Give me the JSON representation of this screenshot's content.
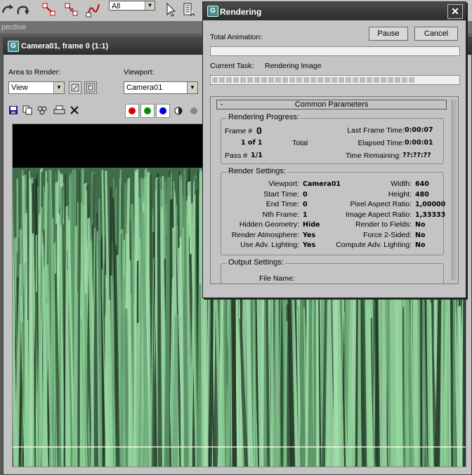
{
  "toolbar": {
    "filter_value": "All",
    "filter_arrow": "▼",
    "icons": [
      "undo-icon",
      "select-link-icon",
      "unlink-icon",
      "bind-space-warp-icon",
      "select-object-icon",
      "select-by-name-icon"
    ]
  },
  "viewport_label": "pective",
  "frame_window": {
    "title": "Camera01, frame 0 (1:1)",
    "app_icon": "G",
    "area_label": "Area to Render:",
    "area_value": "View",
    "viewport_label": "Viewport:",
    "viewport_value": "Camera01",
    "colors": {
      "red": "#e00000",
      "green": "#009000",
      "blue": "#0000d0"
    }
  },
  "rendering_dialog": {
    "title": "Rendering",
    "app_icon": "G",
    "close_glyph": "✕",
    "total_animation_label": "Total Animation:",
    "pause_label": "Pause",
    "cancel_label": "Cancel",
    "current_task_label": "Current Task:",
    "current_task_value": "Rendering Image",
    "current_task_progress": 0.84,
    "total_animation_progress": 0.0,
    "rollout_title": "Common Parameters",
    "rollout_toggle": "-",
    "progress": {
      "group_label": "Rendering Progress:",
      "frame_label": "Frame #",
      "frame_value": "0",
      "of_value": "1 of 1",
      "total_label": "Total",
      "pass_label": "Pass #",
      "pass_value": "1/1",
      "last_frame_time_label": "Last Frame Time:",
      "last_frame_time": "0:00:07",
      "elapsed_time_label": "Elapsed Time:",
      "elapsed_time": "0:00:01",
      "time_remaining_label": "Time Remaining:",
      "time_remaining": "??:??:??"
    },
    "settings": {
      "group_label": "Render Settings:",
      "left": [
        {
          "label": "Viewport:",
          "value": "Camera01"
        },
        {
          "label": "Start Time:",
          "value": "0"
        },
        {
          "label": "End Time:",
          "value": "0"
        },
        {
          "label": "Nth Frame:",
          "value": "1"
        },
        {
          "label": "Hidden Geometry:",
          "value": "Hide"
        },
        {
          "label": "Render Atmosphere:",
          "value": "Yes"
        },
        {
          "label": "Use Adv. Lighting:",
          "value": "Yes"
        }
      ],
      "right": [
        {
          "label": "Width:",
          "value": "640"
        },
        {
          "label": "Height:",
          "value": "480"
        },
        {
          "label": "Pixel Aspect Ratio:",
          "value": "1,00000"
        },
        {
          "label": "Image Aspect Ratio:",
          "value": "1,33333"
        },
        {
          "label": "Render to Fields:",
          "value": "No"
        },
        {
          "label": "Force 2-Sided:",
          "value": "No"
        },
        {
          "label": "Compute Adv. Lighting:",
          "value": "No"
        }
      ]
    },
    "output": {
      "group_label": "Output Settings:",
      "file_name_label": "File Name:"
    }
  }
}
